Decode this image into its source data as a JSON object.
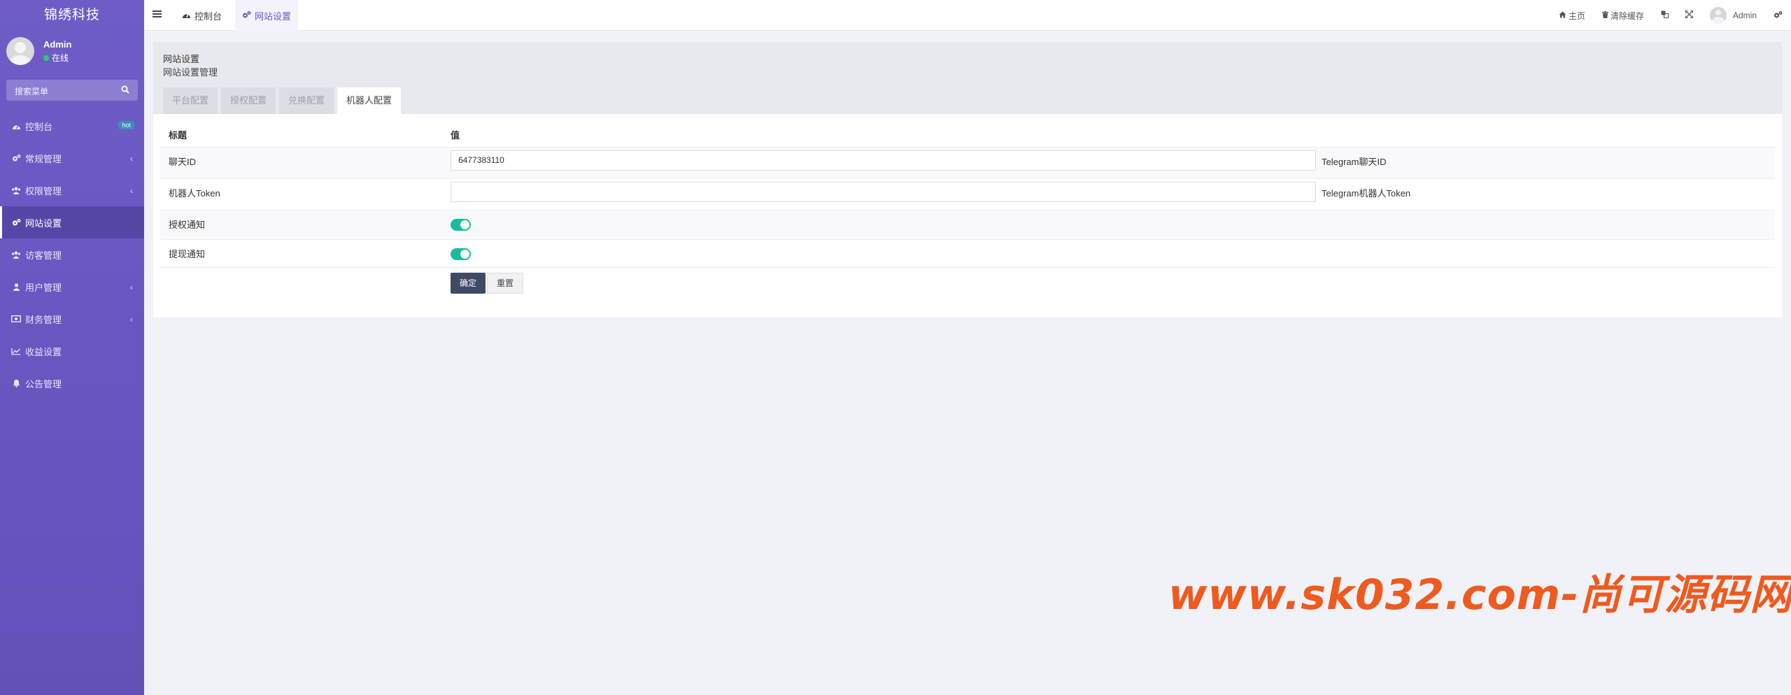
{
  "app": {
    "brand": "锦绣科技"
  },
  "user": {
    "name": "Admin",
    "status": "在线"
  },
  "search": {
    "placeholder": "搜索菜单"
  },
  "menu": [
    {
      "label": "控制台",
      "icon": "dashboard-icon",
      "badge": "hot"
    },
    {
      "label": "常规管理",
      "icon": "cogs-icon"
    },
    {
      "label": "权限管理",
      "icon": "group-icon"
    },
    {
      "label": "网站设置",
      "icon": "cogs-icon",
      "active": true
    },
    {
      "label": "访客管理",
      "icon": "group-icon"
    },
    {
      "label": "用户管理",
      "icon": "user-icon"
    },
    {
      "label": "财务管理",
      "icon": "money-icon"
    },
    {
      "label": "收益设置",
      "icon": "line-chart-icon"
    },
    {
      "label": "公告管理",
      "icon": "bell-icon"
    }
  ],
  "topbar": {
    "tabs": [
      {
        "label": "控制台",
        "icon": "dashboard-icon"
      },
      {
        "label": "网站设置",
        "icon": "cogs-icon",
        "active": true
      }
    ],
    "home": "主页",
    "clear_cache": "清除缓存",
    "admin": "Admin"
  },
  "panel": {
    "title": "网站设置",
    "subtitle": "网站设置管理",
    "tabs": [
      "平台配置",
      "授权配置",
      "兑换配置",
      "机器人配置"
    ],
    "active_tab": "机器人配置"
  },
  "table": {
    "headers": {
      "title": "标题",
      "value": "值"
    },
    "rows": {
      "chat_id": {
        "label": "聊天ID",
        "value": "6477383110",
        "tip": "Telegram聊天ID"
      },
      "bot_token": {
        "label": "机器人Token",
        "value": "",
        "tip": "Telegram机器人Token"
      },
      "auth_notify": {
        "label": "授权通知",
        "enabled": true
      },
      "withdraw_notify": {
        "label": "提现通知",
        "enabled": true
      }
    }
  },
  "buttons": {
    "submit": "确定",
    "reset": "重置"
  },
  "watermark": "www.sk032.com-尚可源码网",
  "colors": {
    "sidebar": "#6a56c0",
    "accent": "#6c5ac8",
    "switch_on": "#18bc9c",
    "primary_btn": "#3f4a65",
    "watermark": "#ef5a1f"
  }
}
